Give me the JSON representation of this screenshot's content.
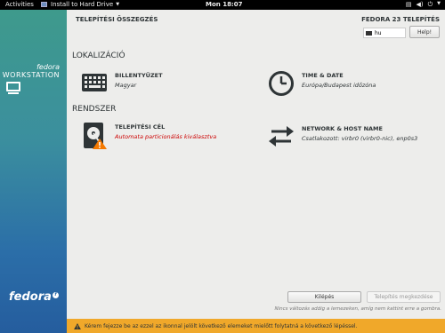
{
  "topbar": {
    "activities": "Activities",
    "app_menu": "Install to Hard Drive",
    "clock": "Mon 18:07"
  },
  "sidebar": {
    "brand_line1": "fedora",
    "brand_line2": "WORKSTATION",
    "logo_text": "fedora"
  },
  "header": {
    "title": "TELEPÍTÉSI ÖSSZEGZÉS",
    "product": "FEDORA 23 TELEPÍTÉS",
    "keyboard_layout": "hu",
    "help_label": "Help!"
  },
  "sections": {
    "localization": "LOKALIZÁCIÓ",
    "system": "RENDSZER"
  },
  "spokes": {
    "keyboard": {
      "title": "BILLENTYŰZET",
      "status": "Magyar"
    },
    "datetime": {
      "title": "TIME & DATE",
      "status": "Európa/Budapest időzóna"
    },
    "destination": {
      "title": "TELEPÍTÉSI CÉL",
      "status": "Automata particionálás kiválasztva"
    },
    "network": {
      "title": "NETWORK & HOST NAME",
      "status": "Csatlakozott: virbr0 (virbr0-nic), enp0s3"
    }
  },
  "footer": {
    "quit_label": "Kilépés",
    "begin_label": "Telepítés megkezdése",
    "note": "Nincs változás addig a lemezeken, amíg nem kattint erre a gombra.",
    "warning": "Kérem fejezze be az ezzel az ikonnal jelölt következő elemeket mielőtt folytatná a következő lépéssel."
  },
  "colors": {
    "sidebar_top": "#3e9a8c",
    "sidebar_bottom": "#255d9e",
    "warning_bar": "#f0a82a",
    "warning_text": "#cc0000"
  }
}
